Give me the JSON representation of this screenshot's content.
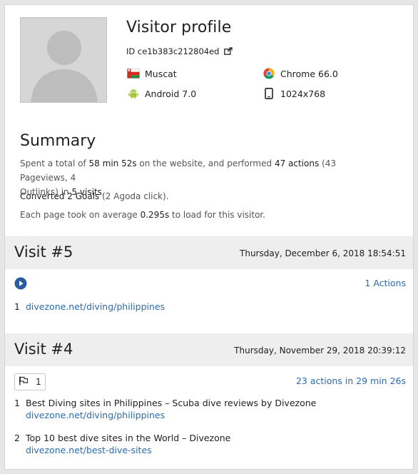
{
  "profile": {
    "title": "Visitor profile",
    "id_label": "ID ce1b383c212804ed",
    "city": "Muscat",
    "browser": "Chrome 66.0",
    "os": "Android 7.0",
    "resolution": "1024x768"
  },
  "summary": {
    "title": "Summary",
    "line1": {
      "p1": "Spent a total of ",
      "time": "58 min 52s",
      "p2": " on the website, and performed ",
      "actions": "47 actions",
      "p3": " (43 Pageviews, 4",
      "p4": "Outlinks) in ",
      "visits": "5 visits",
      "p5": "."
    },
    "line2": {
      "converted": "Converted 2 Goals",
      "detail": " (2 Agoda click)."
    },
    "line3": {
      "p1": "Each page took on average ",
      "avg": "0.295s",
      "p2": " to load for this visitor."
    }
  },
  "visits": [
    {
      "title": "Visit #5",
      "date": "Thursday, December 6, 2018 18:54:51",
      "actions_label": "1 Actions",
      "items": [
        {
          "num": "1",
          "url": "divezone.net/diving/philippines"
        }
      ]
    },
    {
      "title": "Visit #4",
      "date": "Thursday, November 29, 2018 20:39:12",
      "actions_label": "23 actions in 29 min 26s",
      "goal_count": "1",
      "items": [
        {
          "num": "1",
          "title": "Best Diving sites in Philippines – Scuba dive reviews by Divezone",
          "url": "divezone.net/diving/philippines"
        },
        {
          "num": "2",
          "title": "Top 10 best dive sites in the World – Divezone",
          "url": "divezone.net/best-dive-sites"
        }
      ]
    }
  ],
  "colors": {
    "link": "#2a6bb0",
    "header_bg": "#eeeeee",
    "play_icon": "#2b5d9e",
    "flag_red": "#d52b1e",
    "android_green": "#a4c639"
  },
  "icons": {
    "external": "external-link-icon",
    "flag": "oman-flag-icon",
    "browser": "chrome-icon",
    "os": "android-icon",
    "device": "tablet-icon",
    "play": "play-icon",
    "goal": "goal-flag-icon"
  }
}
